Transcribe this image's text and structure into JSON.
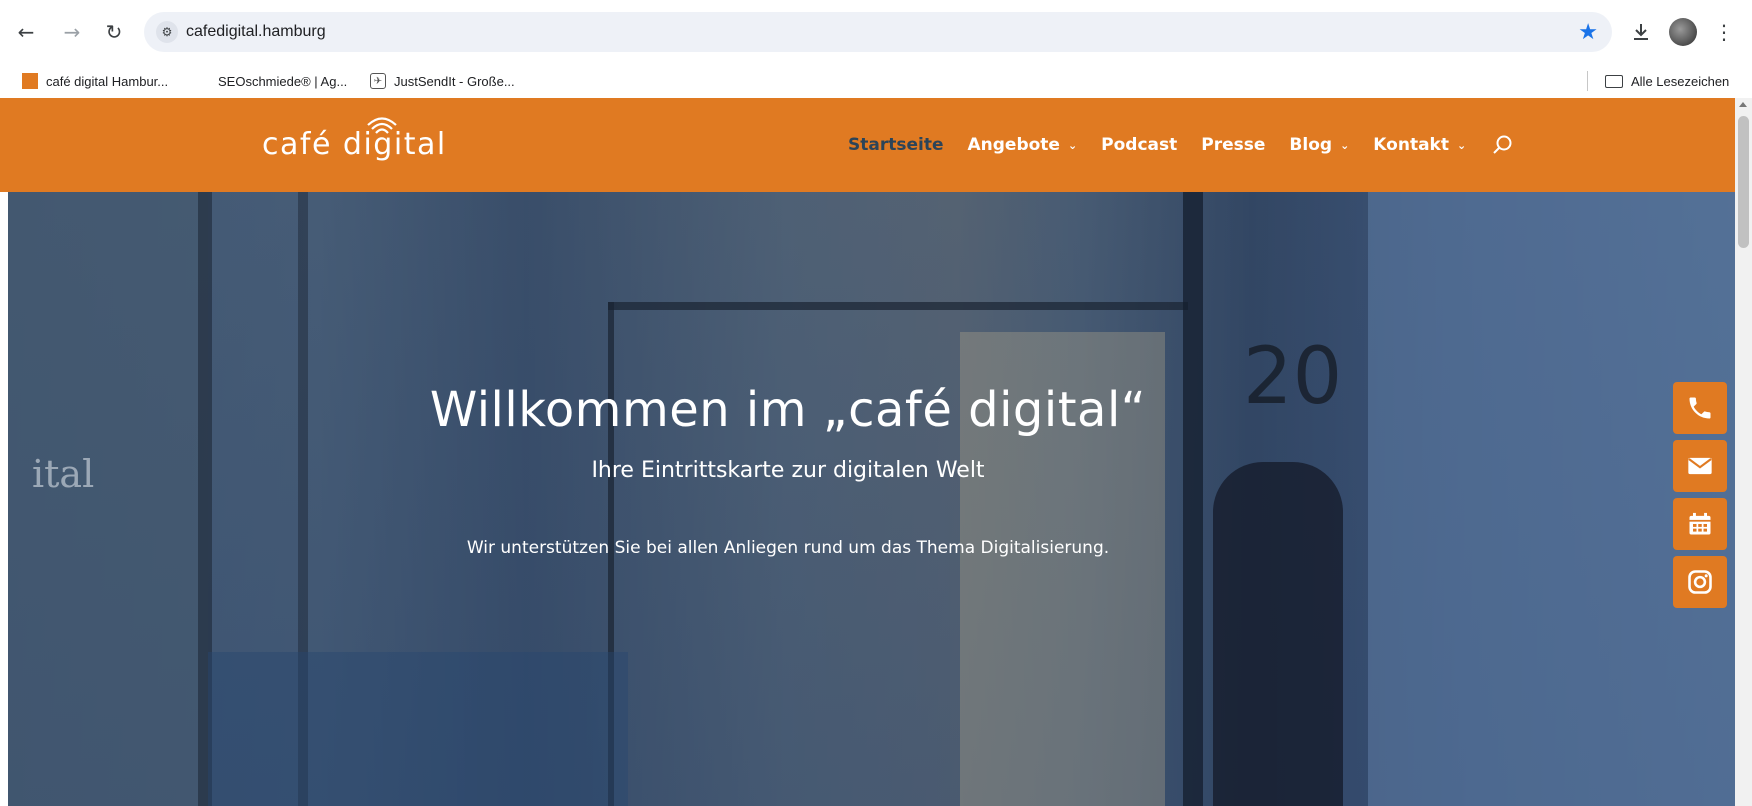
{
  "browser": {
    "url": "cafedigital.hamburg",
    "icons": {
      "back": "arrow-left-icon",
      "forward": "arrow-right-icon",
      "reload": "reload-icon",
      "site_info": "tune-icon",
      "bookmark_star": "star-icon",
      "download": "download-icon",
      "profile": "avatar",
      "menu": "more-vert-icon"
    }
  },
  "bookmarks": {
    "items": [
      {
        "label": "café digital Hambur..."
      },
      {
        "label": "SEOschmiede® | Ag..."
      },
      {
        "label": "JustSendIt - Große..."
      }
    ],
    "all_bookmarks": "Alle Lesezeichen"
  },
  "site": {
    "logo_text": "café digital",
    "brand_color": "#e07a22",
    "active_nav_color": "#2c4458",
    "nav": [
      {
        "label": "Startseite",
        "dropdown": false,
        "active": true
      },
      {
        "label": "Angebote",
        "dropdown": true,
        "active": false
      },
      {
        "label": "Podcast",
        "dropdown": false,
        "active": false
      },
      {
        "label": "Presse",
        "dropdown": false,
        "active": false
      },
      {
        "label": "Blog",
        "dropdown": true,
        "active": false
      },
      {
        "label": "Kontakt",
        "dropdown": true,
        "active": false
      }
    ]
  },
  "hero": {
    "title": "Willkommen im „café digital“",
    "subtitle": "Ihre Eintrittskarte zur digitalen Welt",
    "text": "Wir unterstützen Sie bei allen Anliegen rund um das Thema Digitalisierung.",
    "background_letters": "ital",
    "door_number": "20"
  },
  "floating_buttons": [
    {
      "icon": "phone-icon"
    },
    {
      "icon": "mail-icon"
    },
    {
      "icon": "calendar-icon"
    },
    {
      "icon": "instagram-icon"
    }
  ]
}
